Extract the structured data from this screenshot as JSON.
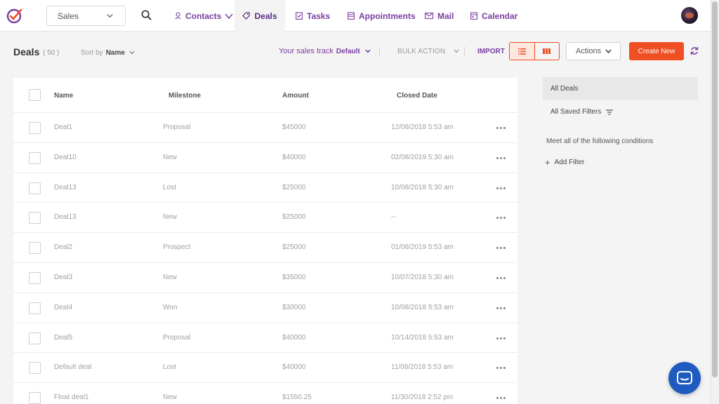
{
  "nav": {
    "module": "Sales",
    "items": [
      {
        "label": "Contacts",
        "icon": "user-icon"
      },
      {
        "label": "Deals",
        "icon": "tag-icon"
      },
      {
        "label": "Tasks",
        "icon": "task-icon"
      },
      {
        "label": "Appointments",
        "icon": "calendar-grid-icon"
      },
      {
        "label": "Mail",
        "icon": "mail-icon"
      },
      {
        "label": "Calendar",
        "icon": "calendar-icon"
      }
    ]
  },
  "header": {
    "title": "Deals",
    "count": "( 50 )",
    "sort_label": "Sort by",
    "sort_value": "Name",
    "track_label": "Your sales track",
    "track_value": "Default",
    "bulk_action": "BULK ACTION",
    "import": "IMPORT",
    "actions": "Actions",
    "create_new": "Create New"
  },
  "table": {
    "columns": [
      "Name",
      "Milestone",
      "Amount",
      "Closed Date"
    ],
    "rows": [
      {
        "name": "Deal1",
        "milestone": "Proposal",
        "amount": "$45000",
        "closed": "12/08/2018 5:53 am"
      },
      {
        "name": "Deal10",
        "milestone": "New",
        "amount": "$40000",
        "closed": "02/08/2019 5:30 am"
      },
      {
        "name": "Deal13",
        "milestone": "Lost",
        "amount": "$25000",
        "closed": "10/08/2018 5:30 am"
      },
      {
        "name": "Deal13",
        "milestone": "New",
        "amount": "$25000",
        "closed": "--"
      },
      {
        "name": "Deal2",
        "milestone": "Prospect",
        "amount": "$25000",
        "closed": "01/08/2019 5:53 am"
      },
      {
        "name": "Deal3",
        "milestone": "New",
        "amount": "$35000",
        "closed": "10/07/2018 5:30 am"
      },
      {
        "name": "Deal4",
        "milestone": "Won",
        "amount": "$30000",
        "closed": "10/08/2018 5:53 am"
      },
      {
        "name": "Deal5",
        "milestone": "Proposal",
        "amount": "$40000",
        "closed": "10/14/2018 5:53 am"
      },
      {
        "name": "Default deal",
        "milestone": "Lost",
        "amount": "$40000",
        "closed": "11/08/2018 5:53 am"
      },
      {
        "name": "Float deal1",
        "milestone": "New",
        "amount": "$1550.25",
        "closed": "11/30/2018 2:52 pm"
      }
    ]
  },
  "filters": {
    "all_deals": "All Deals",
    "saved": "All Saved Filters",
    "conditions": "Meet all of the following conditions",
    "add_filter": "Add Filter"
  },
  "colors": {
    "accent": "#f04e23",
    "brand": "#7a3ea0",
    "chat": "#1f5bbf"
  }
}
